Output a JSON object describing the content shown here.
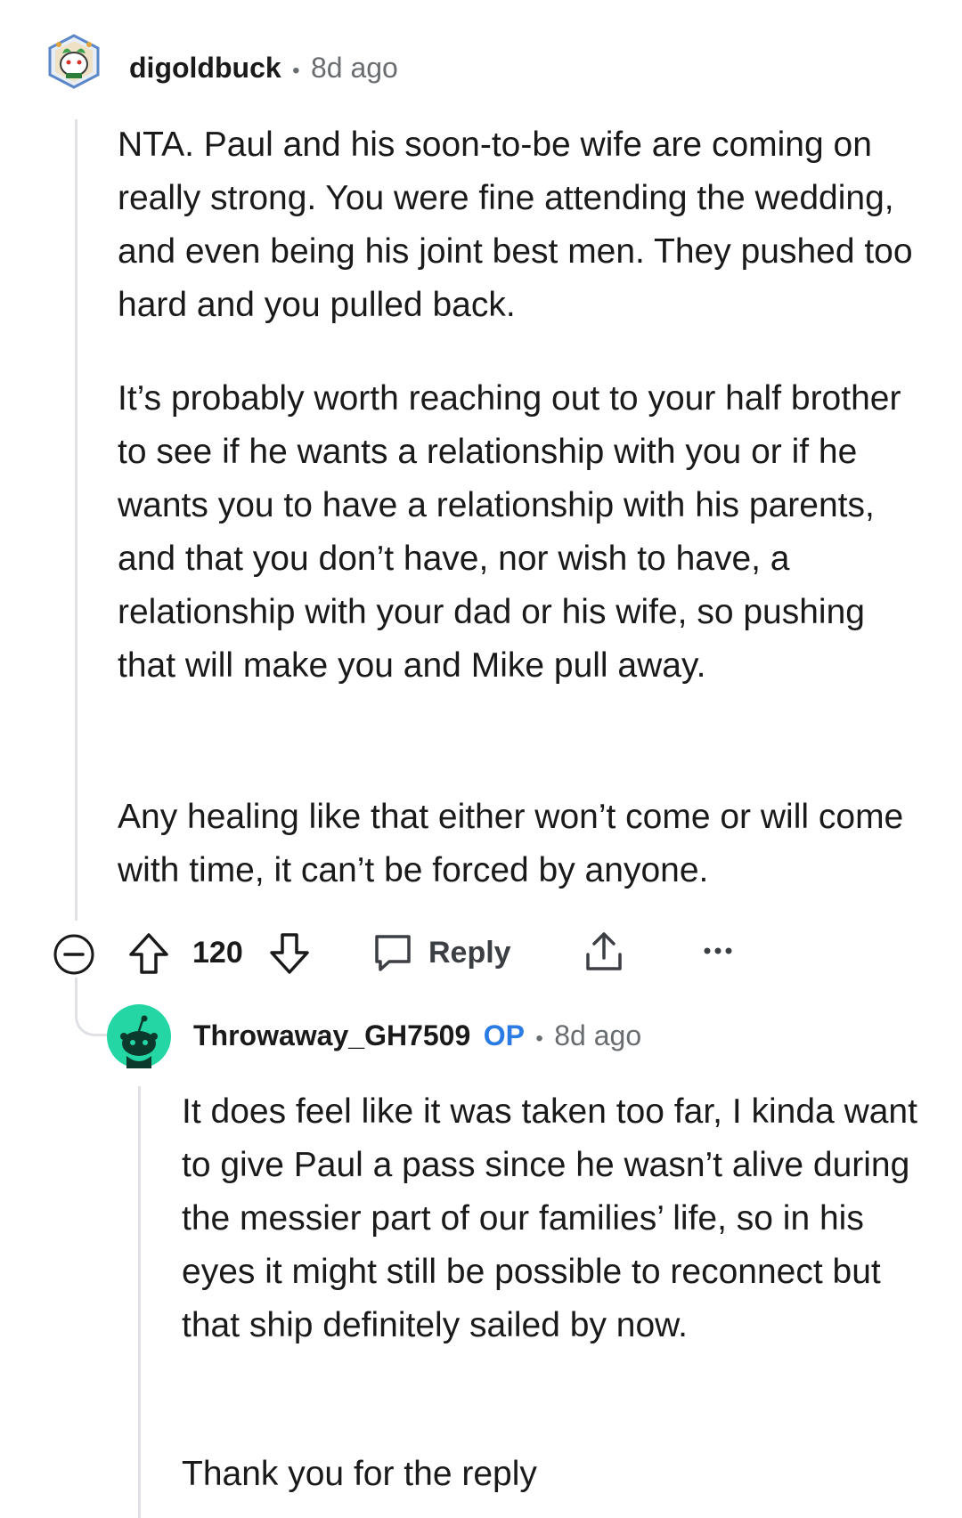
{
  "comment": {
    "username": "digoldbuck",
    "separator": "•",
    "time": "8d ago",
    "paragraphs": [
      "NTA. Paul and his soon-to-be wife are coming on really strong. You were fine attending the wedding, and even being his joint best men. They pushed too hard and you pulled back.",
      "It’s probably worth reaching out to your half brother to see if he wants a relationship with you or if he wants you to have a relationship with his parents, and that you don’t have, nor wish to have, a relationship with your dad or his wife, so pushing that will make you and Mike pull away.",
      "Any healing like that either won’t come or will come with time, it can’t be forced by anyone."
    ],
    "actions": {
      "vote_count": "120",
      "reply_label": "Reply"
    }
  },
  "reply": {
    "username": "Throwaway_GH7509",
    "op_badge": "OP",
    "separator": "•",
    "time": "8d ago",
    "paragraphs": [
      "It does feel like it was taken too far, I kinda want to give Paul a pass since he wasn’t alive during the messier part of our families’ life, so in his eyes it might still be possible to reconnect but that ship definitely sailed by now.",
      "Thank you for the reply"
    ]
  },
  "colors": {
    "text": "#1a1a1b",
    "meta": "#6a6d70",
    "op_badge": "#2a7be4",
    "thread_line": "#dfe1e4",
    "snoo_avatar_bg": "#24d6a4"
  },
  "icons": [
    "collapse-icon",
    "upvote-icon",
    "downvote-icon",
    "reply-icon",
    "share-icon",
    "more-options-icon"
  ]
}
